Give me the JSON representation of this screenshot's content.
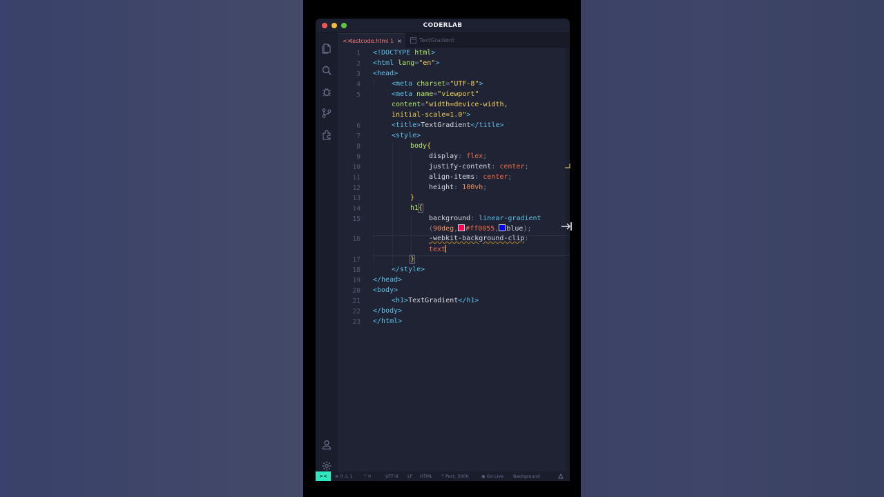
{
  "window": {
    "title": "CODERLAB"
  },
  "tabs": [
    {
      "icon": "<>",
      "label": "testcode.html 1",
      "close": "×",
      "active": true
    },
    {
      "label": "TextGradient",
      "active": false
    }
  ],
  "lines": [
    {
      "n": "1"
    },
    {
      "n": "2"
    },
    {
      "n": "3"
    },
    {
      "n": "4"
    },
    {
      "n": "5"
    },
    {
      "n": "6"
    },
    {
      "n": "7"
    },
    {
      "n": "8"
    },
    {
      "n": "9"
    },
    {
      "n": "10"
    },
    {
      "n": "11"
    },
    {
      "n": "12"
    },
    {
      "n": "13"
    },
    {
      "n": "14"
    },
    {
      "n": "15"
    },
    {
      "n": "16"
    },
    {
      "n": "17"
    },
    {
      "n": "18"
    },
    {
      "n": "19"
    },
    {
      "n": "20"
    },
    {
      "n": "21"
    },
    {
      "n": "22"
    },
    {
      "n": "23"
    }
  ],
  "code": {
    "l1a": "<!DOCTYPE",
    "l1b": " html",
    "l1c": ">",
    "l2a": "<html",
    "l2b": " lang",
    "l2c": "=",
    "l2d": "\"en\"",
    "l2e": ">",
    "l3": "<head>",
    "l4a": "<meta",
    "l4b": " charset",
    "l4c": "=",
    "l4d": "\"UTF-8\"",
    "l4e": ">",
    "l5a": "<meta",
    "l5b": " name",
    "l5c": "=",
    "l5d": "\"viewport\"",
    "l5e": "content",
    "l5f": "=",
    "l5g": "\"width=device-width,",
    "l5h": "initial-scale=1.0\"",
    "l5i": ">",
    "l6a": "<title>",
    "l6b": "TextGradient",
    "l6c": "</title>",
    "l7": "<style>",
    "l8a": "body",
    "l8b": "{",
    "l9a": "display",
    "l9b": ": ",
    "l9c": "flex",
    "l9d": ";",
    "l10a": "justify-content",
    "l10b": ": ",
    "l10c": "center",
    "l10d": ";",
    "l11a": "align-items",
    "l11b": ": ",
    "l11c": "center",
    "l11d": ";",
    "l12a": "height",
    "l12b": ": ",
    "l12c": "100vh",
    "l12d": ";",
    "l13": "}",
    "l14a": "h1",
    "l14b": "{",
    "l15a": "background",
    "l15b": ": ",
    "l15c": "linear-gradient",
    "l15d": "(",
    "l15e": "90deg",
    "l15f": ",",
    "l15g": "#ff0055",
    "l15h": ",",
    "l15i": "blue",
    "l15j": ");",
    "l16a": "-webkit-background-clip",
    "l16b": ":",
    "l16c": "text",
    "l17": "}",
    "l18": "</style>",
    "l19": "</head>",
    "l20": "<body>",
    "l21a": "<h1>",
    "l21b": "TextGradient",
    "l21c": "</h1>",
    "l22": "</body>",
    "l23": "</html>"
  },
  "colors": {
    "swatch_pink": "#ff0055",
    "swatch_blue": "#0000ff"
  },
  "status": {
    "remote": "><",
    "problems": "⊗ 0 ⚠ 1",
    "ports": "ᛘ 0",
    "encoding": "UTF-8",
    "eol": "LF",
    "language": "HTML",
    "port": "ᛘ Port: 3000",
    "golive": "◉ Go Live",
    "background": "Background"
  }
}
